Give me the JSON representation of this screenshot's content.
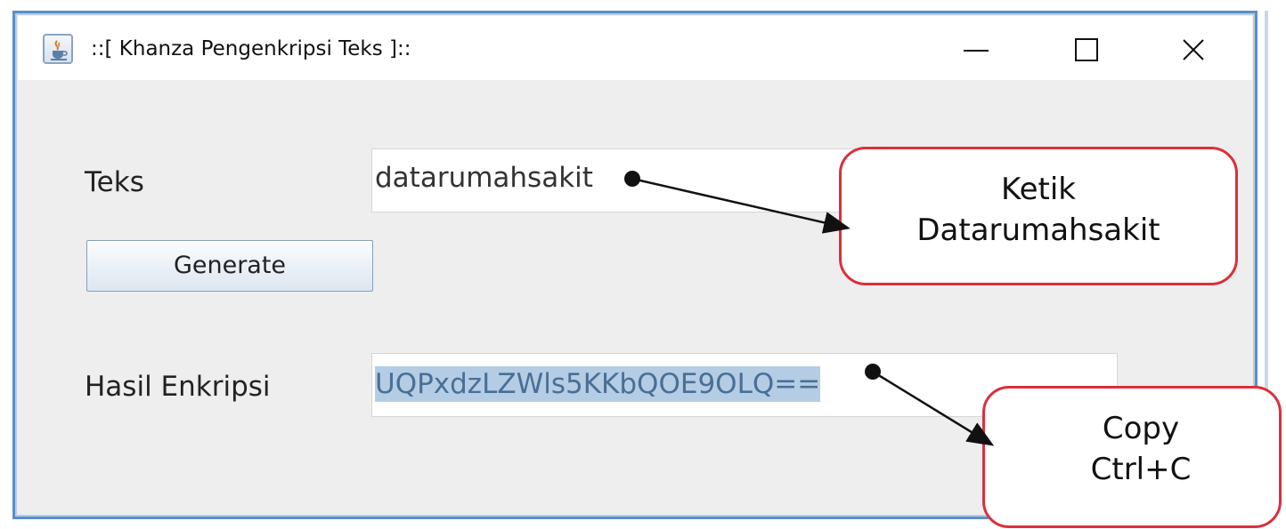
{
  "window": {
    "title": "::[ Khanza Pengenkripsi Teks ]::",
    "icon": "java-cup-icon",
    "controls": [
      "minimize-icon",
      "maximize-icon",
      "close-icon"
    ]
  },
  "form": {
    "teks_label": "Teks",
    "teks_value": "datarumahsakit",
    "generate_label": "Generate",
    "hasil_label": "Hasil Enkripsi",
    "hasil_value": "UQPxdzLZWls5KKbQOE9OLQ=="
  },
  "annotations": {
    "ketik": {
      "line1": "Ketik",
      "line2": "Datarumahsakit"
    },
    "copy": {
      "line1": "Copy",
      "line2": "Ctrl+C"
    },
    "color": "#dc2f3c"
  }
}
